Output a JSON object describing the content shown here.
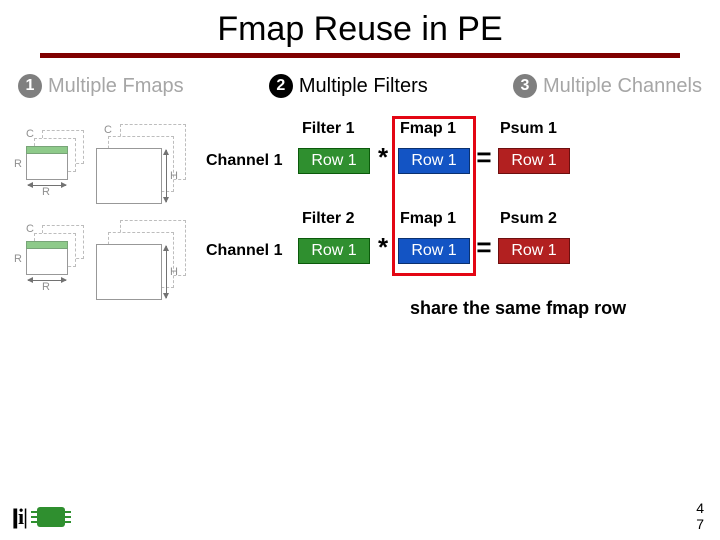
{
  "title": "Fmap Reuse in PE",
  "modes": {
    "m1": {
      "num": "1",
      "label": "Multiple Fmaps"
    },
    "m2": {
      "num": "2",
      "label": "Multiple Filters"
    },
    "m3": {
      "num": "3",
      "label": "Multiple Channels"
    }
  },
  "diagram_labels": {
    "C": "C",
    "R": "R",
    "H": "H"
  },
  "eq": {
    "channel_label": "Channel 1",
    "row1": {
      "filter_head": "Filter 1",
      "fmap_head": "Fmap 1",
      "psum_head": "Psum 1",
      "filter_val": "Row 1",
      "fmap_val": "Row 1",
      "psum_val": "Row 1"
    },
    "row2": {
      "filter_head": "Filter 2",
      "fmap_head": "Fmap 1",
      "psum_head": "Psum 2",
      "filter_val": "Row 1",
      "fmap_val": "Row 1",
      "psum_val": "Row 1"
    },
    "ops": {
      "star": "*",
      "eq": "="
    }
  },
  "share_note": "share the same fmap row",
  "page": {
    "a": "4",
    "b": "7"
  }
}
